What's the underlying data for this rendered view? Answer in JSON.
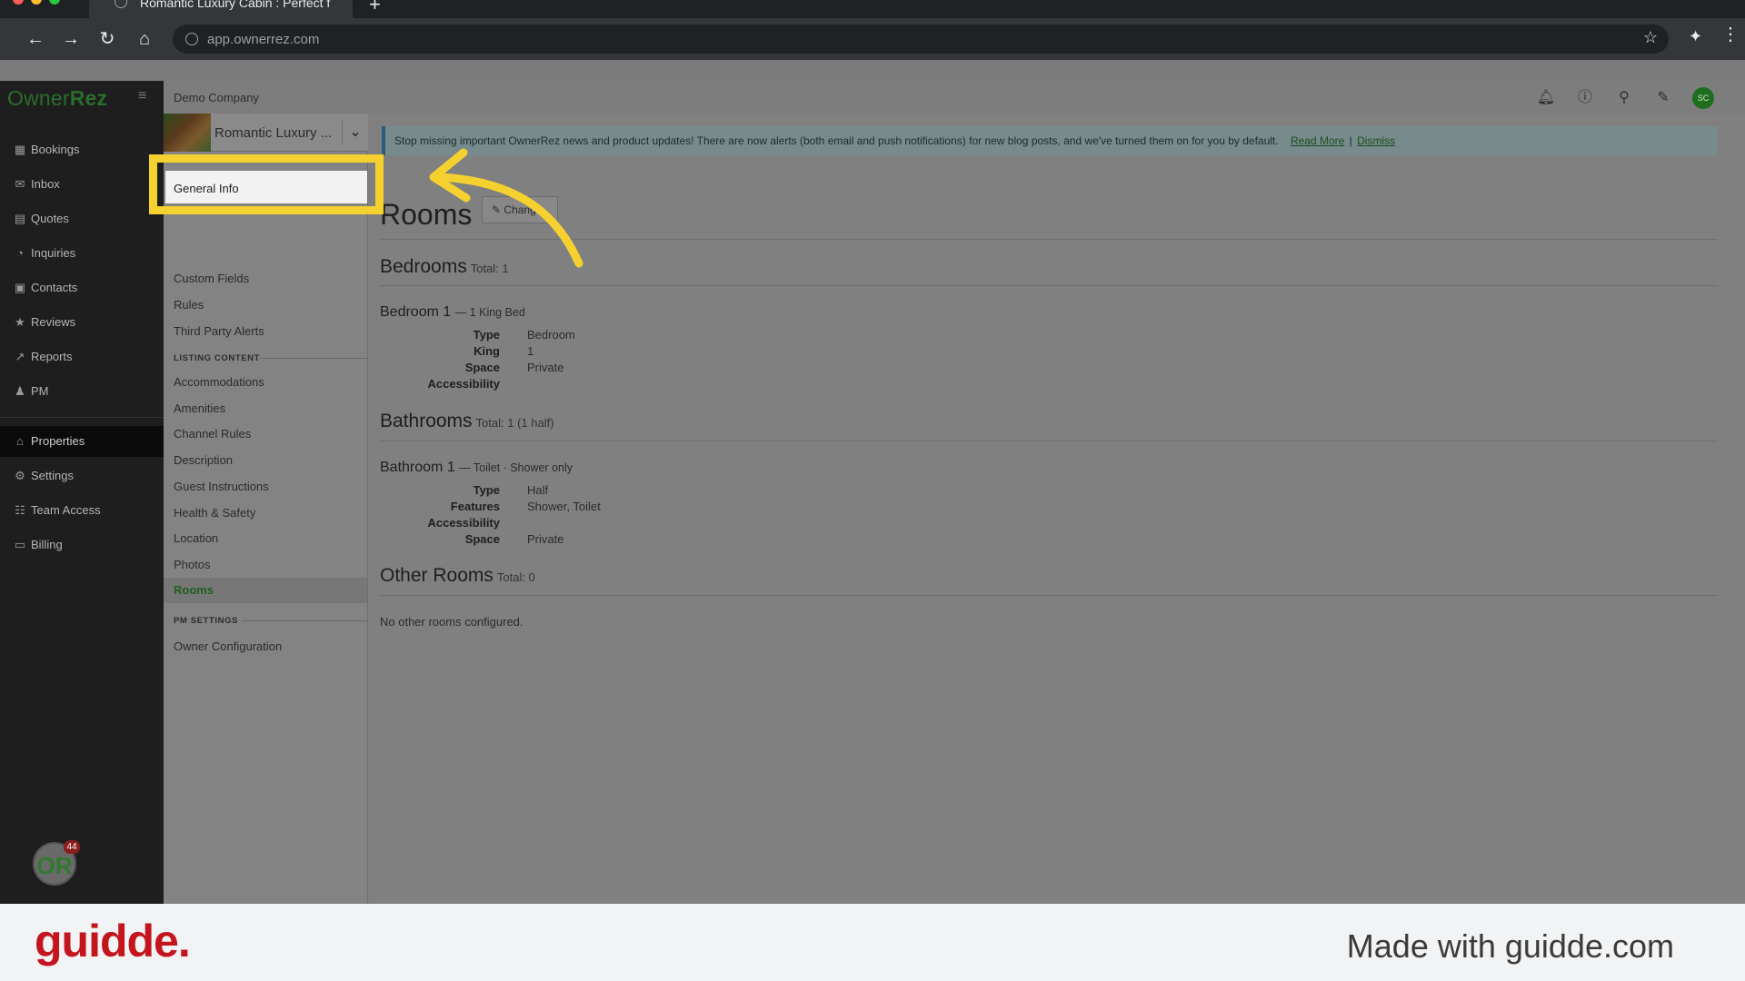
{
  "browser": {
    "tab_title": "Romantic Luxury Cabin : Perfect f",
    "url": "app.ownerrez.com"
  },
  "app": {
    "logo_text_a": "Owner",
    "logo_text_b": "Rez",
    "company": "Demo Company",
    "user_initials": "SC",
    "notification_count": "44",
    "avatar_text": "OR"
  },
  "sidebar": {
    "items": [
      {
        "label": "Bookings",
        "icon": "calendar-icon"
      },
      {
        "label": "Inbox",
        "icon": "envelope-icon"
      },
      {
        "label": "Quotes",
        "icon": "document-icon"
      },
      {
        "label": "Inquiries",
        "icon": "chat-icon"
      },
      {
        "label": "Contacts",
        "icon": "address-book-icon"
      },
      {
        "label": "Reviews",
        "icon": "star-icon"
      },
      {
        "label": "Reports",
        "icon": "chart-icon"
      },
      {
        "label": "PM",
        "icon": "person-icon"
      },
      {
        "label": "Properties",
        "icon": "home-icon"
      },
      {
        "label": "Settings",
        "icon": "gear-icon"
      },
      {
        "label": "Team Access",
        "icon": "team-icon"
      },
      {
        "label": "Billing",
        "icon": "credit-card-icon"
      }
    ]
  },
  "subnav": {
    "property_name": "Romantic Luxury ...",
    "highlighted_item": "General Info",
    "items_top": [
      "Custom Fields",
      "Rules",
      "Third Party Alerts"
    ],
    "listing_header": "LISTING CONTENT",
    "listing_items": [
      "Accommodations",
      "Amenities",
      "Channel Rules",
      "Description",
      "Guest Instructions",
      "Health & Safety",
      "Location",
      "Photos"
    ],
    "active_item": "Rooms",
    "pm_header": "PM SETTINGS",
    "pm_items": [
      "Owner Configuration"
    ]
  },
  "alert": {
    "text": "Stop missing important OwnerRez news and product updates! There are now alerts (both email and push notifications) for new blog posts, and we've turned them on for you by default.",
    "read_more": "Read More",
    "separator": "|",
    "dismiss": "Dismiss"
  },
  "main": {
    "title": "Rooms",
    "change_button": "Chang",
    "bedrooms": {
      "heading": "Bedrooms",
      "total": "Total: 1",
      "room_title": "Bedroom 1",
      "room_sub": "— 1 King Bed",
      "fields": [
        {
          "label": "Type",
          "value": "Bedroom"
        },
        {
          "label": "King",
          "value": "1"
        },
        {
          "label": "Space",
          "value": "Private"
        },
        {
          "label": "Accessibility",
          "value": ""
        }
      ]
    },
    "bathrooms": {
      "heading": "Bathrooms",
      "total": "Total: 1 (1 half)",
      "room_title": "Bathroom 1",
      "room_sub": "— Toilet · Shower only",
      "fields": [
        {
          "label": "Type",
          "value": "Half"
        },
        {
          "label": "Features",
          "value": "Shower, Toilet"
        },
        {
          "label": "Accessibility",
          "value": ""
        },
        {
          "label": "Space",
          "value": "Private"
        }
      ]
    },
    "other": {
      "heading": "Other Rooms",
      "total": "Total: 0",
      "empty_text": "No other rooms configured."
    }
  },
  "footer": {
    "brand": "guidde.",
    "made_with": "Made with guidde.com"
  },
  "colors": {
    "highlight": "#f5d130",
    "guidde_red": "#c4141e",
    "brand_green": "#2a6d2a"
  }
}
